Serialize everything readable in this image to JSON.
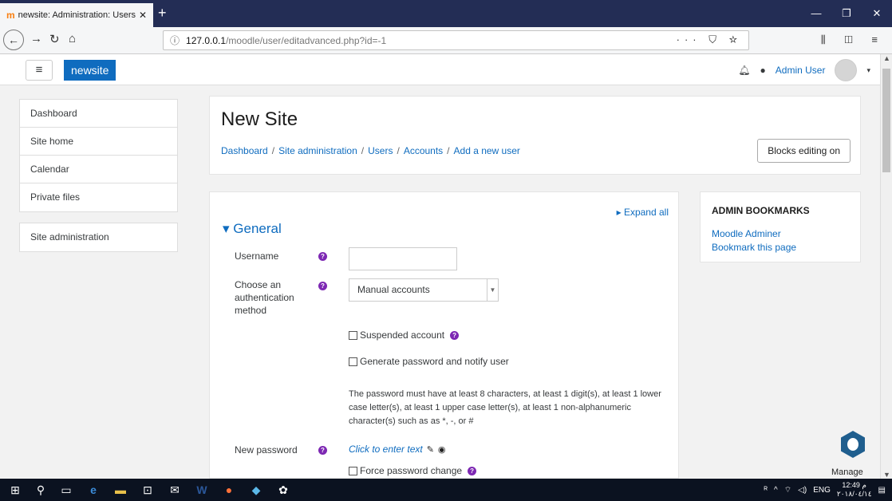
{
  "browser": {
    "tab_title": "newsite: Administration: Users",
    "url_host": "127.0.0.1",
    "url_path": "/moodle/user/editadvanced.php?id=-1"
  },
  "header": {
    "brand": "newsite",
    "user_name": "Admin User"
  },
  "sidebar": {
    "items": [
      "Dashboard",
      "Site home",
      "Calendar",
      "Private files"
    ],
    "admin": "Site administration"
  },
  "page": {
    "title": "New Site",
    "breadcrumb": [
      "Dashboard",
      "Site administration",
      "Users",
      "Accounts",
      "Add a new user"
    ],
    "blocks_button": "Blocks editing on"
  },
  "form": {
    "expand_all": "Expand all",
    "section": "General",
    "username_label": "Username",
    "auth_label": "Choose an authentication method",
    "auth_value": "Manual accounts",
    "suspended": "Suspended account",
    "generate_pw": "Generate password and notify user",
    "pw_rules": "The password must have at least 8 characters, at least 1 digit(s), at least 1 lower case letter(s), at least 1 upper case letter(s), at least 1 non-alphanumeric character(s) such as as *, -, or #",
    "newpw_label": "New password",
    "newpw_value": "Click to enter text",
    "force_change": "Force password change"
  },
  "bookmarks": {
    "title": "ADMIN BOOKMARKS",
    "links": [
      "Moodle Adminer",
      "Bookmark this page"
    ]
  },
  "manage": "Manage",
  "taskbar": {
    "lang": "ENG",
    "time": "12:49 م",
    "date": "٢٠١٨/٠٤/١٤"
  }
}
